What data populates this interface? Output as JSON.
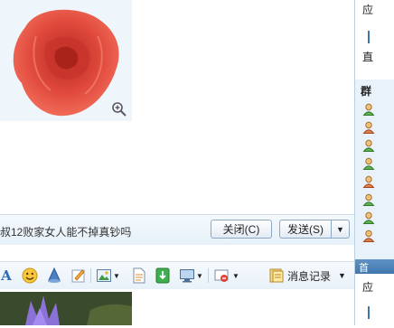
{
  "chat": {
    "status_text": "叔12败家女人能不掉真钞吗",
    "close_label": "关闭(C)",
    "send_label": "发送(S)",
    "send_dropdown": "▼"
  },
  "toolbar": {
    "font_icon_text": "A",
    "history_label": "消息记录",
    "history_dropdown": "▼"
  },
  "sidebar": {
    "top_char": "应",
    "mid_char": "直",
    "group_char": "群",
    "bottom_tab_char": "首",
    "bottom_char": "应"
  },
  "colors": {
    "rose": "#d9443a",
    "accent": "#3f77ad",
    "bar_bg": "#e6f0f8"
  },
  "icons": [
    "font-icon",
    "smiley-icon",
    "bell-icon",
    "note-icon",
    "image-icon",
    "file-icon",
    "app-icon",
    "screen-icon",
    "capture-icon",
    "message-history-icon",
    "zoom-icon",
    "member-icon"
  ]
}
